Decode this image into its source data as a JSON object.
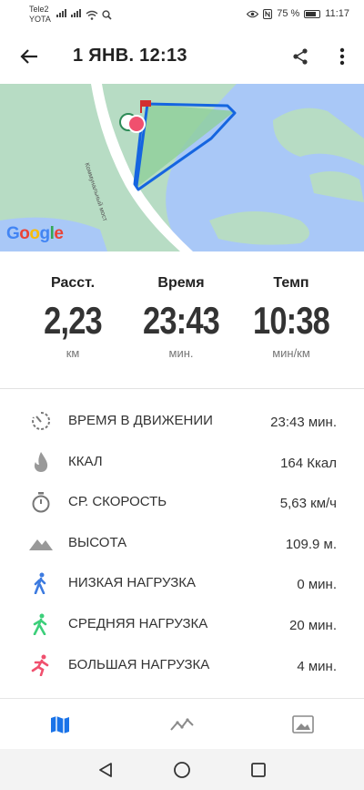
{
  "status_bar": {
    "carrier_1": "Tele2",
    "carrier_2": "YOTA",
    "battery": "75 %",
    "time": "11:17"
  },
  "app_bar": {
    "title": "1 ЯНВ. 12:13"
  },
  "map": {
    "provider_logo": "Google",
    "bridge_label": "Коммунальный мост"
  },
  "summary": [
    {
      "label": "Расст.",
      "value": "2,23",
      "unit": "км"
    },
    {
      "label": "Время",
      "value": "23:43",
      "unit": "мин."
    },
    {
      "label": "Темп",
      "value": "10:38",
      "unit": "мин/км"
    }
  ],
  "details": [
    {
      "icon": "timer-outline-icon",
      "label": "ВРЕМЯ В ДВИЖЕНИИ",
      "value": "23:43 мин."
    },
    {
      "icon": "flame-icon",
      "label": "ККАЛ",
      "value": "164 Ккал"
    },
    {
      "icon": "stopwatch-icon",
      "label": "СР. СКОРОСТЬ",
      "value": "5,63 км/ч"
    },
    {
      "icon": "mountain-icon",
      "label": "ВЫСОТА",
      "value": "109.9 м."
    },
    {
      "icon": "walking-person-icon",
      "label": "НИЗКАЯ НАГРУЗКА",
      "value": "0 мин."
    },
    {
      "icon": "walking-person-icon",
      "label": "СРЕДНЯЯ НАГРУЗКА",
      "value": "20 мин."
    },
    {
      "icon": "running-person-icon",
      "label": "БОЛЬШАЯ НАГРУЗКА",
      "value": "4 мин."
    }
  ],
  "colors": {
    "accent": "#1a73e8",
    "low_load": "#3d7be0",
    "medium_load": "#3ccf7a",
    "high_load": "#f0506e",
    "route": "#1565e0",
    "map_land": "#b7dcc4",
    "map_water": "#a9c8f7"
  },
  "tabs": [
    {
      "name": "map",
      "icon": "map-icon",
      "active": true
    },
    {
      "name": "chart",
      "icon": "line-chart-icon",
      "active": false
    },
    {
      "name": "photo",
      "icon": "image-icon",
      "active": false
    }
  ]
}
